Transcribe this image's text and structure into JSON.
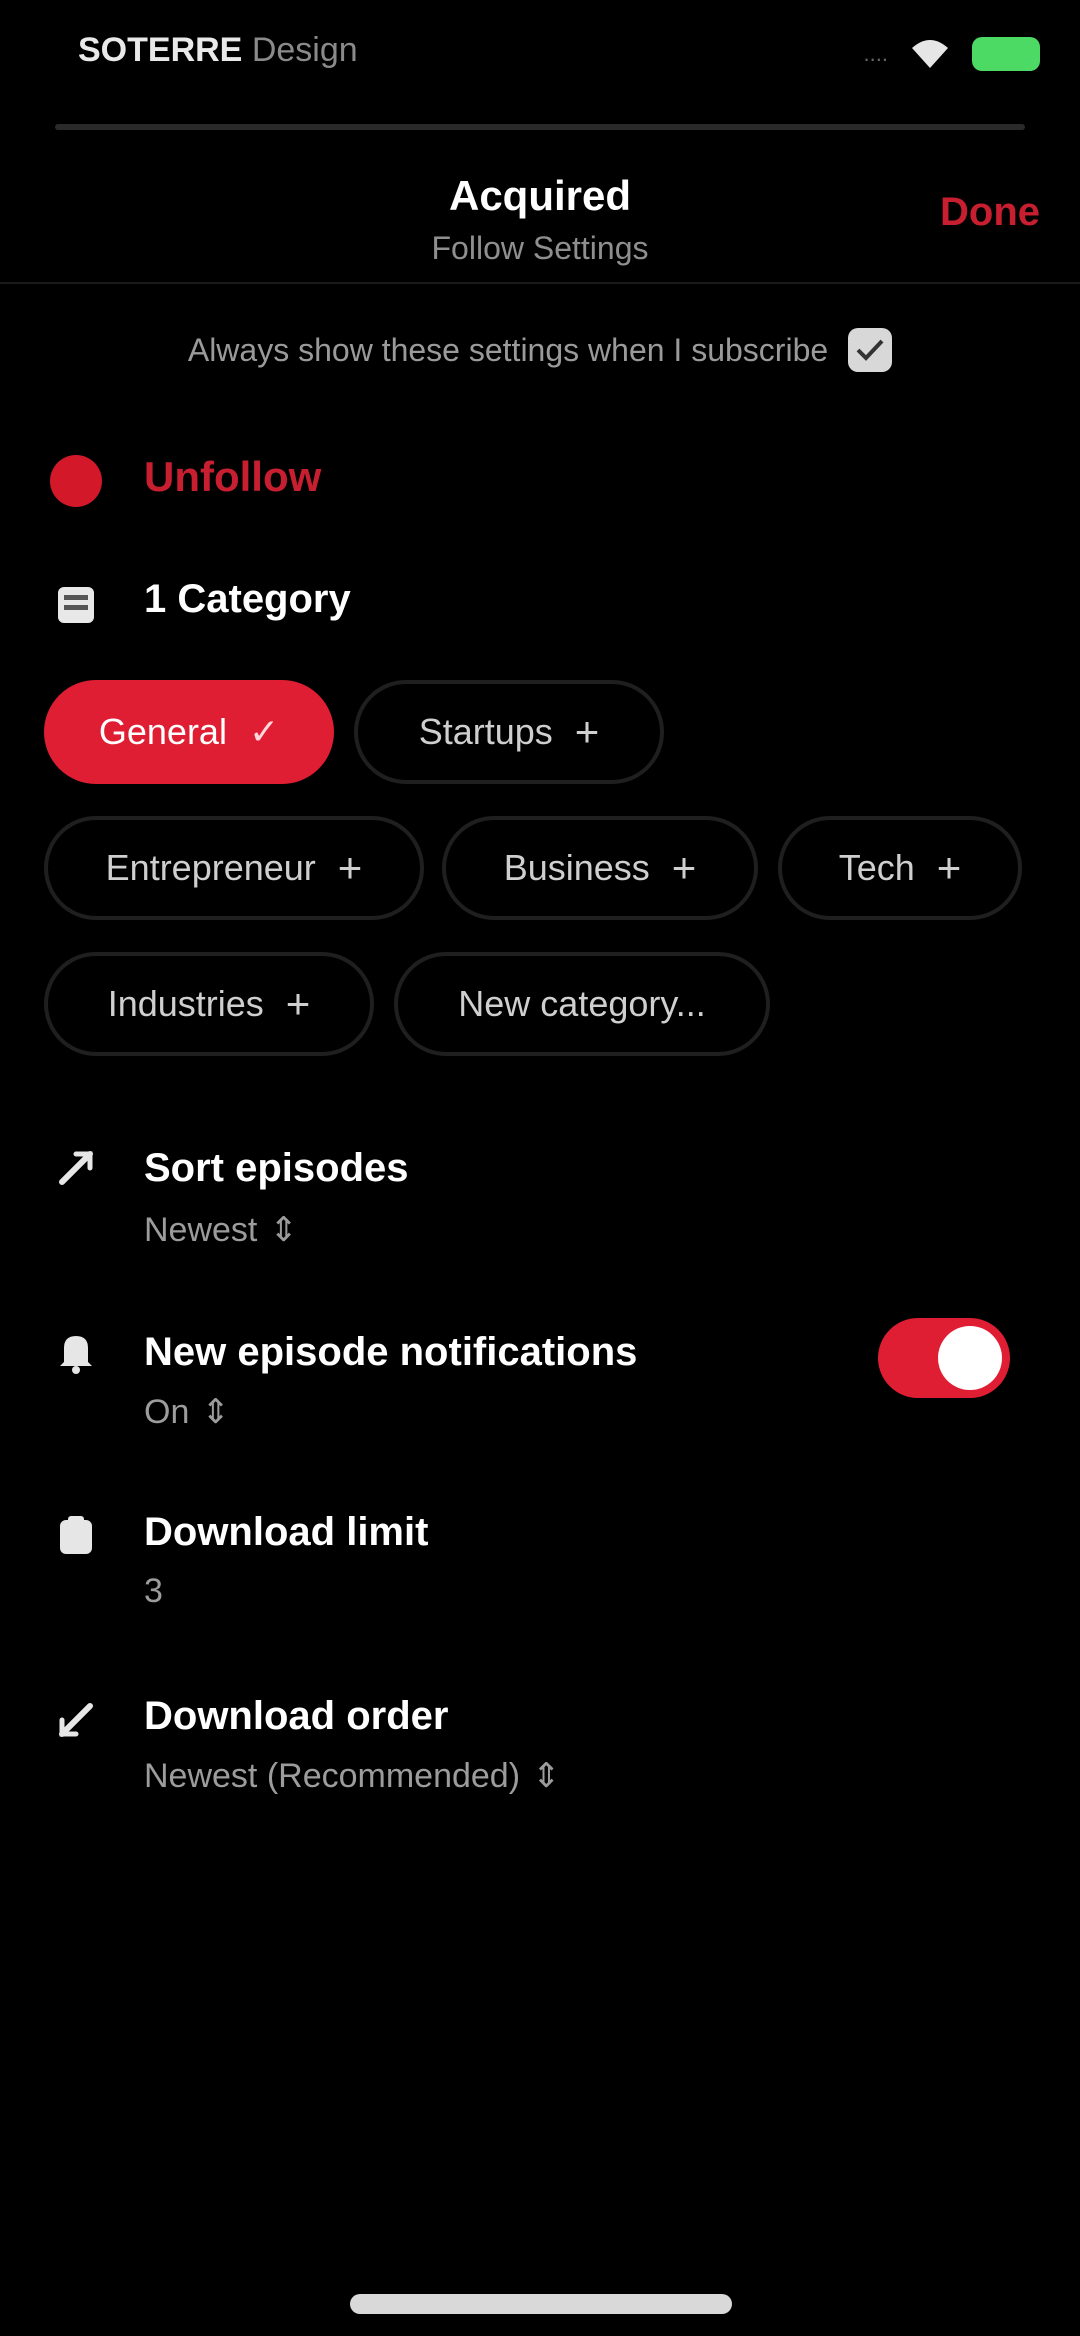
{
  "status_bar": {
    "carrier": "SOTERRE",
    "carrier_dim": "Design",
    "signal": "....",
    "battery_color": "#4cd964"
  },
  "header": {
    "title": "Acquired",
    "subtitle": "Follow Settings",
    "done_label": "Done"
  },
  "always_show": {
    "label": "Always show these settings when I subscribe",
    "checked": true
  },
  "unfollow": {
    "label": "Unfollow"
  },
  "categories": {
    "count_label": "1 Category",
    "chips": [
      {
        "label": "General",
        "selected": true
      },
      {
        "label": "Startups",
        "selected": false
      },
      {
        "label": "Entrepreneur",
        "selected": false
      },
      {
        "label": "Business",
        "selected": false
      },
      {
        "label": "Tech",
        "selected": false
      },
      {
        "label": "Industries",
        "selected": false
      },
      {
        "label": "New category...",
        "selected": false
      }
    ]
  },
  "settings": {
    "sort_episodes": {
      "title": "Sort episodes",
      "value": "Newest"
    },
    "notifications": {
      "title": "New episode notifications",
      "value": "On",
      "enabled": true
    },
    "download_limit": {
      "title": "Download limit",
      "value": "3"
    },
    "download_order": {
      "title": "Download order",
      "value": "Newest (Recommended)"
    }
  },
  "colors": {
    "accent": "#e01e33",
    "background": "#000000",
    "secondary_text": "#9c9c9c"
  }
}
